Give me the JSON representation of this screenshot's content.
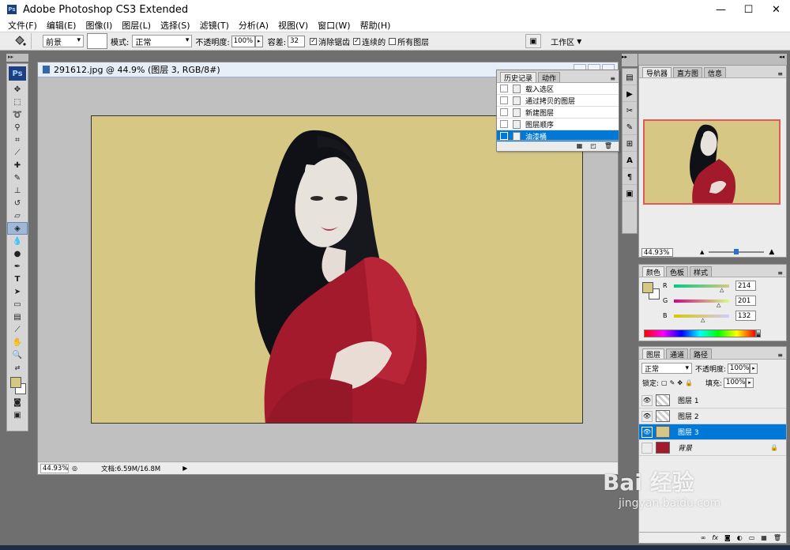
{
  "app": {
    "title": "Adobe Photoshop CS3 Extended",
    "icon_text": "Ps"
  },
  "window_controls": {
    "minimize": "—",
    "maximize": "☐",
    "close": "✕"
  },
  "menu": [
    "文件(F)",
    "编辑(E)",
    "图像(I)",
    "图层(L)",
    "选择(S)",
    "滤镜(T)",
    "分析(A)",
    "视图(V)",
    "窗口(W)",
    "帮助(H)"
  ],
  "options": {
    "fill_source": "前景",
    "mode_label": "模式:",
    "mode_value": "正常",
    "opacity_label": "不透明度:",
    "opacity_value": "100%",
    "tolerance_label": "容差:",
    "tolerance_value": "32",
    "antialias_label": "消除锯齿",
    "contiguous_label": "连续的",
    "all_layers_label": "所有图层",
    "workspace_label": "工作区"
  },
  "toolbox": {
    "ps_label": "Ps",
    "foreground_color": "#d6c884",
    "background_color": "#ffffff"
  },
  "document": {
    "title": "291612.jpg @ 44.9% (图层 3, RGB/8#)",
    "zoom": "44.93%",
    "doc_size": "文档:6.59M/16.8M",
    "canvas_color": "#d6c884"
  },
  "history": {
    "tabs": [
      "历史记录",
      "动作"
    ],
    "items": [
      "载入选区",
      "通过拷贝的图层",
      "新建图层",
      "图层顺序",
      "油漆桶"
    ],
    "selected": 4
  },
  "navigator": {
    "tabs": [
      "导航器",
      "直方图",
      "信息"
    ],
    "zoom": "44.93%"
  },
  "color": {
    "tabs": [
      "颜色",
      "色板",
      "样式"
    ],
    "r_label": "R",
    "g_label": "G",
    "b_label": "B",
    "r": "214",
    "g": "201",
    "b": "132",
    "swatch": "#d6c884"
  },
  "layers": {
    "tabs": [
      "图层",
      "通道",
      "路径"
    ],
    "blend_mode": "正常",
    "opacity_label": "不透明度:",
    "opacity": "100%",
    "lock_label": "锁定:",
    "fill_label": "填充:",
    "fill": "100%",
    "items": [
      {
        "name": "图层 1",
        "selected": false,
        "visible": true,
        "locked": false
      },
      {
        "name": "图层 2",
        "selected": false,
        "visible": true,
        "locked": false
      },
      {
        "name": "图层 3",
        "selected": true,
        "visible": true,
        "locked": false
      },
      {
        "name": "背景",
        "selected": false,
        "visible": false,
        "locked": true
      }
    ]
  },
  "watermark": {
    "brand": "Bai  经验",
    "url": "jingyan.baidu.com"
  }
}
